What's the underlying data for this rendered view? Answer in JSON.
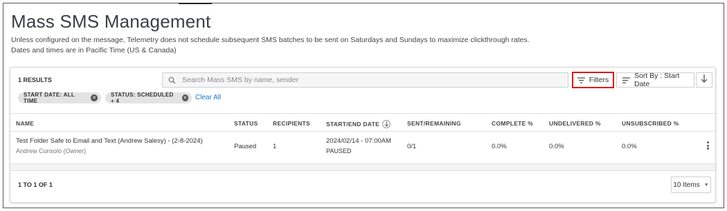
{
  "page": {
    "title": "Mass SMS Management",
    "description_line1": "Unless configured on the message, Telemetry does not schedule subsequent SMS batches to be sent on Saturdays and Sundays to maximize clickthrough rates.",
    "description_line2": "Dates and times are in Pacific Time (US & Canada)"
  },
  "toolbar": {
    "results_count": "1 RESULTS",
    "search_placeholder": "Search Mass SMS by name, sender",
    "filters_label": "Filters",
    "sort_label": "Sort By : Start Date",
    "sort_direction_icon": "arrow-down-icon"
  },
  "filters": {
    "chips": [
      {
        "label": "START DATE: ALL TIME"
      },
      {
        "label": "STATUS: SCHEDULED + 4"
      }
    ],
    "clear_all_label": "Clear All"
  },
  "table": {
    "columns": [
      "NAME",
      "STATUS",
      "RECIPIENTS",
      "START/END DATE",
      "SENT/REMAINING",
      "COMPLETE %",
      "UNDELIVERED %",
      "UNSUBSCRIBED %"
    ],
    "sorted_column": "START/END DATE",
    "rows": [
      {
        "name": "Test Folder Safe to Email and Text (Andrew Salesy) - (2-8-2024)",
        "owner": "Andrew Cunsolo (Owner)",
        "status": "Paused",
        "recipients": "1",
        "start_date": "2024/02/14 - 07:00AM",
        "end_date": "PAUSED",
        "sent_remaining": "0/1",
        "complete_pct": "0.0%",
        "undelivered_pct": "0.0%",
        "unsubscribed_pct": "0.0%"
      }
    ]
  },
  "pagination": {
    "range_text": "1 TO 1 OF 1",
    "page_size_label": "10 Items"
  },
  "colors": {
    "filters_highlight": "#e0141b",
    "link": "#1a73c9"
  }
}
